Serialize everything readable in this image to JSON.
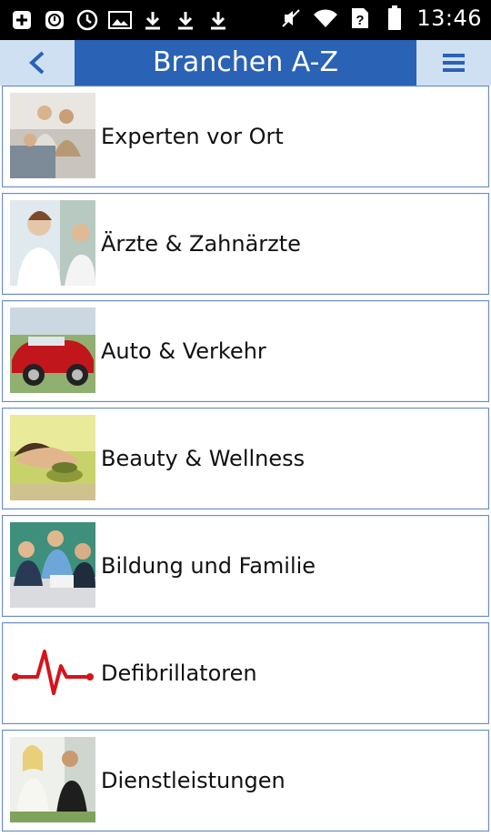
{
  "status_bar": {
    "time": "13:46",
    "icons": [
      "plus-square-icon",
      "sync-icon",
      "clock-icon",
      "image-icon",
      "download-icon",
      "download-icon",
      "download-icon",
      "muted-icon",
      "wifi-icon",
      "no-sim-icon",
      "battery-icon"
    ]
  },
  "header": {
    "back_label": "<",
    "title": "Branchen A-Z",
    "menu_icon": "menu-icon"
  },
  "list": {
    "items": [
      {
        "label": "Experten vor Ort"
      },
      {
        "label": "Ärzte & Zahnärzte"
      },
      {
        "label": "Auto & Verkehr"
      },
      {
        "label": "Beauty & Wellness"
      },
      {
        "label": "Bildung und Familie"
      },
      {
        "label": "Defibrillatoren"
      },
      {
        "label": "Dienstleistungen"
      }
    ]
  },
  "colors": {
    "accent": "#2a62b5",
    "header_button_bg": "#cfe0f2",
    "row_border": "#6b8cc4"
  }
}
